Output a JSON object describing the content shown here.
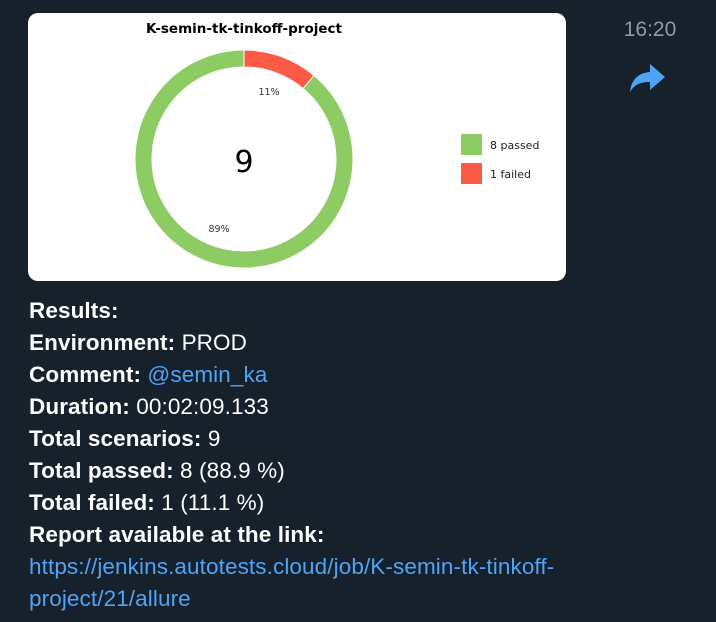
{
  "message": {
    "time": "16:20",
    "icons": {
      "forward": "forward-arrow-icon"
    },
    "colors": {
      "background": "#17212b",
      "link": "#4ea4f6",
      "timestamp": "#8d9aa8",
      "passed": "#8ccc63",
      "failed": "#fb5a44"
    }
  },
  "chart_data": {
    "type": "pie",
    "style": "donut",
    "title": "K-semin-tk-tinkoff-project",
    "center_label": "9",
    "slices": [
      {
        "label": "8 passed",
        "value": 8,
        "percent_label": "89%",
        "color": "#8ccc63"
      },
      {
        "label": "1 failed",
        "value": 1,
        "percent_label": "11%",
        "color": "#fb5a44"
      }
    ],
    "legend": "right"
  },
  "results": {
    "heading": "Results:",
    "environment_label": "Environment:",
    "environment_value": " PROD",
    "comment_label": "Comment:",
    "comment_value": "@semin_ka",
    "duration_label": "Duration:",
    "duration_value": " 00:02:09.133",
    "total_scenarios_label": "Total scenarios:",
    "total_scenarios_value": " 9",
    "total_passed_label": "Total passed:",
    "total_passed_value": " 8 (88.9 %)",
    "total_failed_label": "Total failed:",
    "total_failed_value": " 1 (11.1 %)",
    "report_label": "Report available at the link:",
    "report_link": "https://jenkins.autotests.cloud/job/K-semin-tk-tinkoff-project/21/allure"
  }
}
